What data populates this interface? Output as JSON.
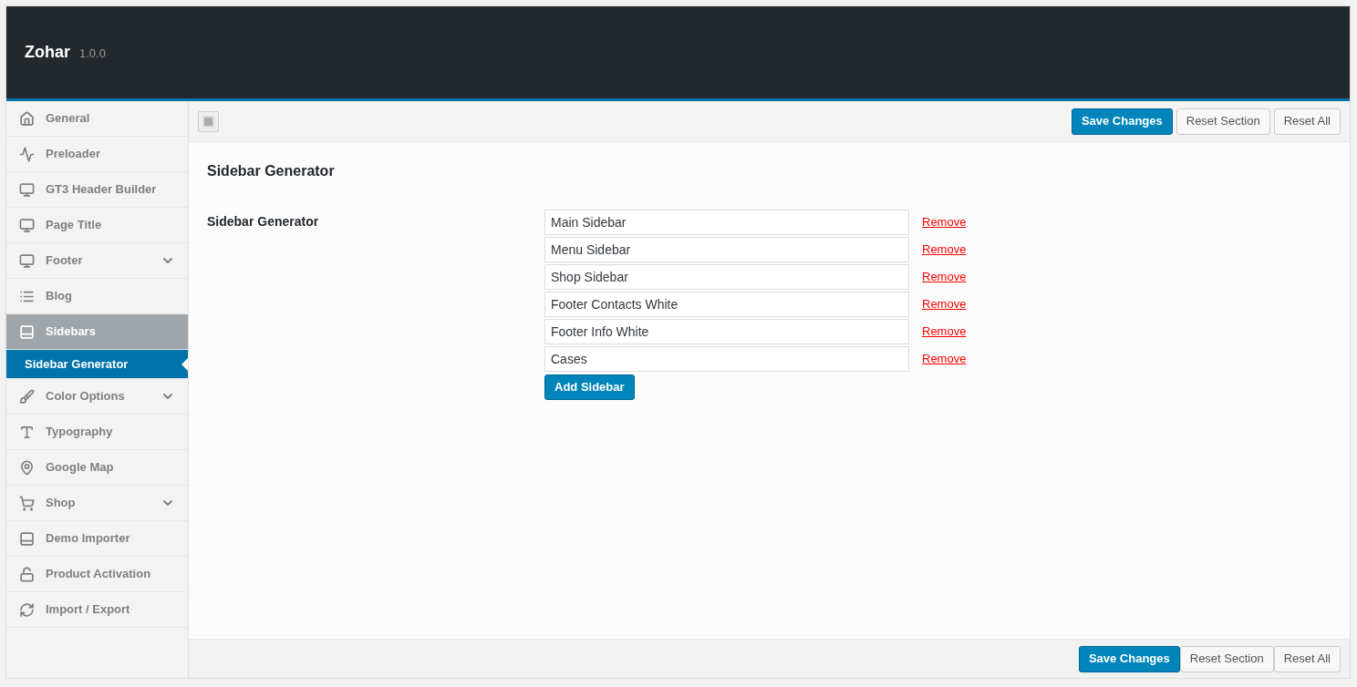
{
  "header": {
    "title": "Zohar",
    "version": "1.0.0"
  },
  "sidebar": {
    "items": [
      {
        "label": "General",
        "selected": false,
        "expandable": false
      },
      {
        "label": "Preloader",
        "selected": false,
        "expandable": false
      },
      {
        "label": "GT3 Header Builder",
        "selected": false,
        "expandable": false
      },
      {
        "label": "Page Title",
        "selected": false,
        "expandable": false
      },
      {
        "label": "Footer",
        "selected": false,
        "expandable": true
      },
      {
        "label": "Blog",
        "selected": false,
        "expandable": false
      },
      {
        "label": "Sidebars",
        "selected": true,
        "expandable": false,
        "children": [
          {
            "label": "Sidebar Generator",
            "selected": true
          }
        ]
      },
      {
        "label": "Color Options",
        "selected": false,
        "expandable": true
      },
      {
        "label": "Typography",
        "selected": false,
        "expandable": false
      },
      {
        "label": "Google Map",
        "selected": false,
        "expandable": false
      },
      {
        "label": "Shop",
        "selected": false,
        "expandable": true
      },
      {
        "label": "Demo Importer",
        "selected": false,
        "expandable": false
      },
      {
        "label": "Product Activation",
        "selected": false,
        "expandable": false
      },
      {
        "label": "Import / Export",
        "selected": false,
        "expandable": false
      }
    ]
  },
  "top_buttons": [
    "Save Changes",
    "Reset Section",
    "Reset All"
  ],
  "section": {
    "title": "Sidebar Generator",
    "field_label": "Sidebar Generator",
    "sidebars": [
      {
        "value": "Main Sidebar",
        "action": "Remove"
      },
      {
        "value": "Menu Sidebar",
        "action": "Remove"
      },
      {
        "value": "Shop Sidebar",
        "action": "Remove"
      },
      {
        "value": "Footer Contacts White",
        "action": "Remove"
      },
      {
        "value": "Footer Info White",
        "action": "Remove"
      },
      {
        "value": "Cases",
        "action": "Remove"
      }
    ],
    "add_button": "Add Sidebar"
  },
  "bottom_buttons": [
    "Save Changes",
    "Reset Section",
    "Reset All"
  ]
}
